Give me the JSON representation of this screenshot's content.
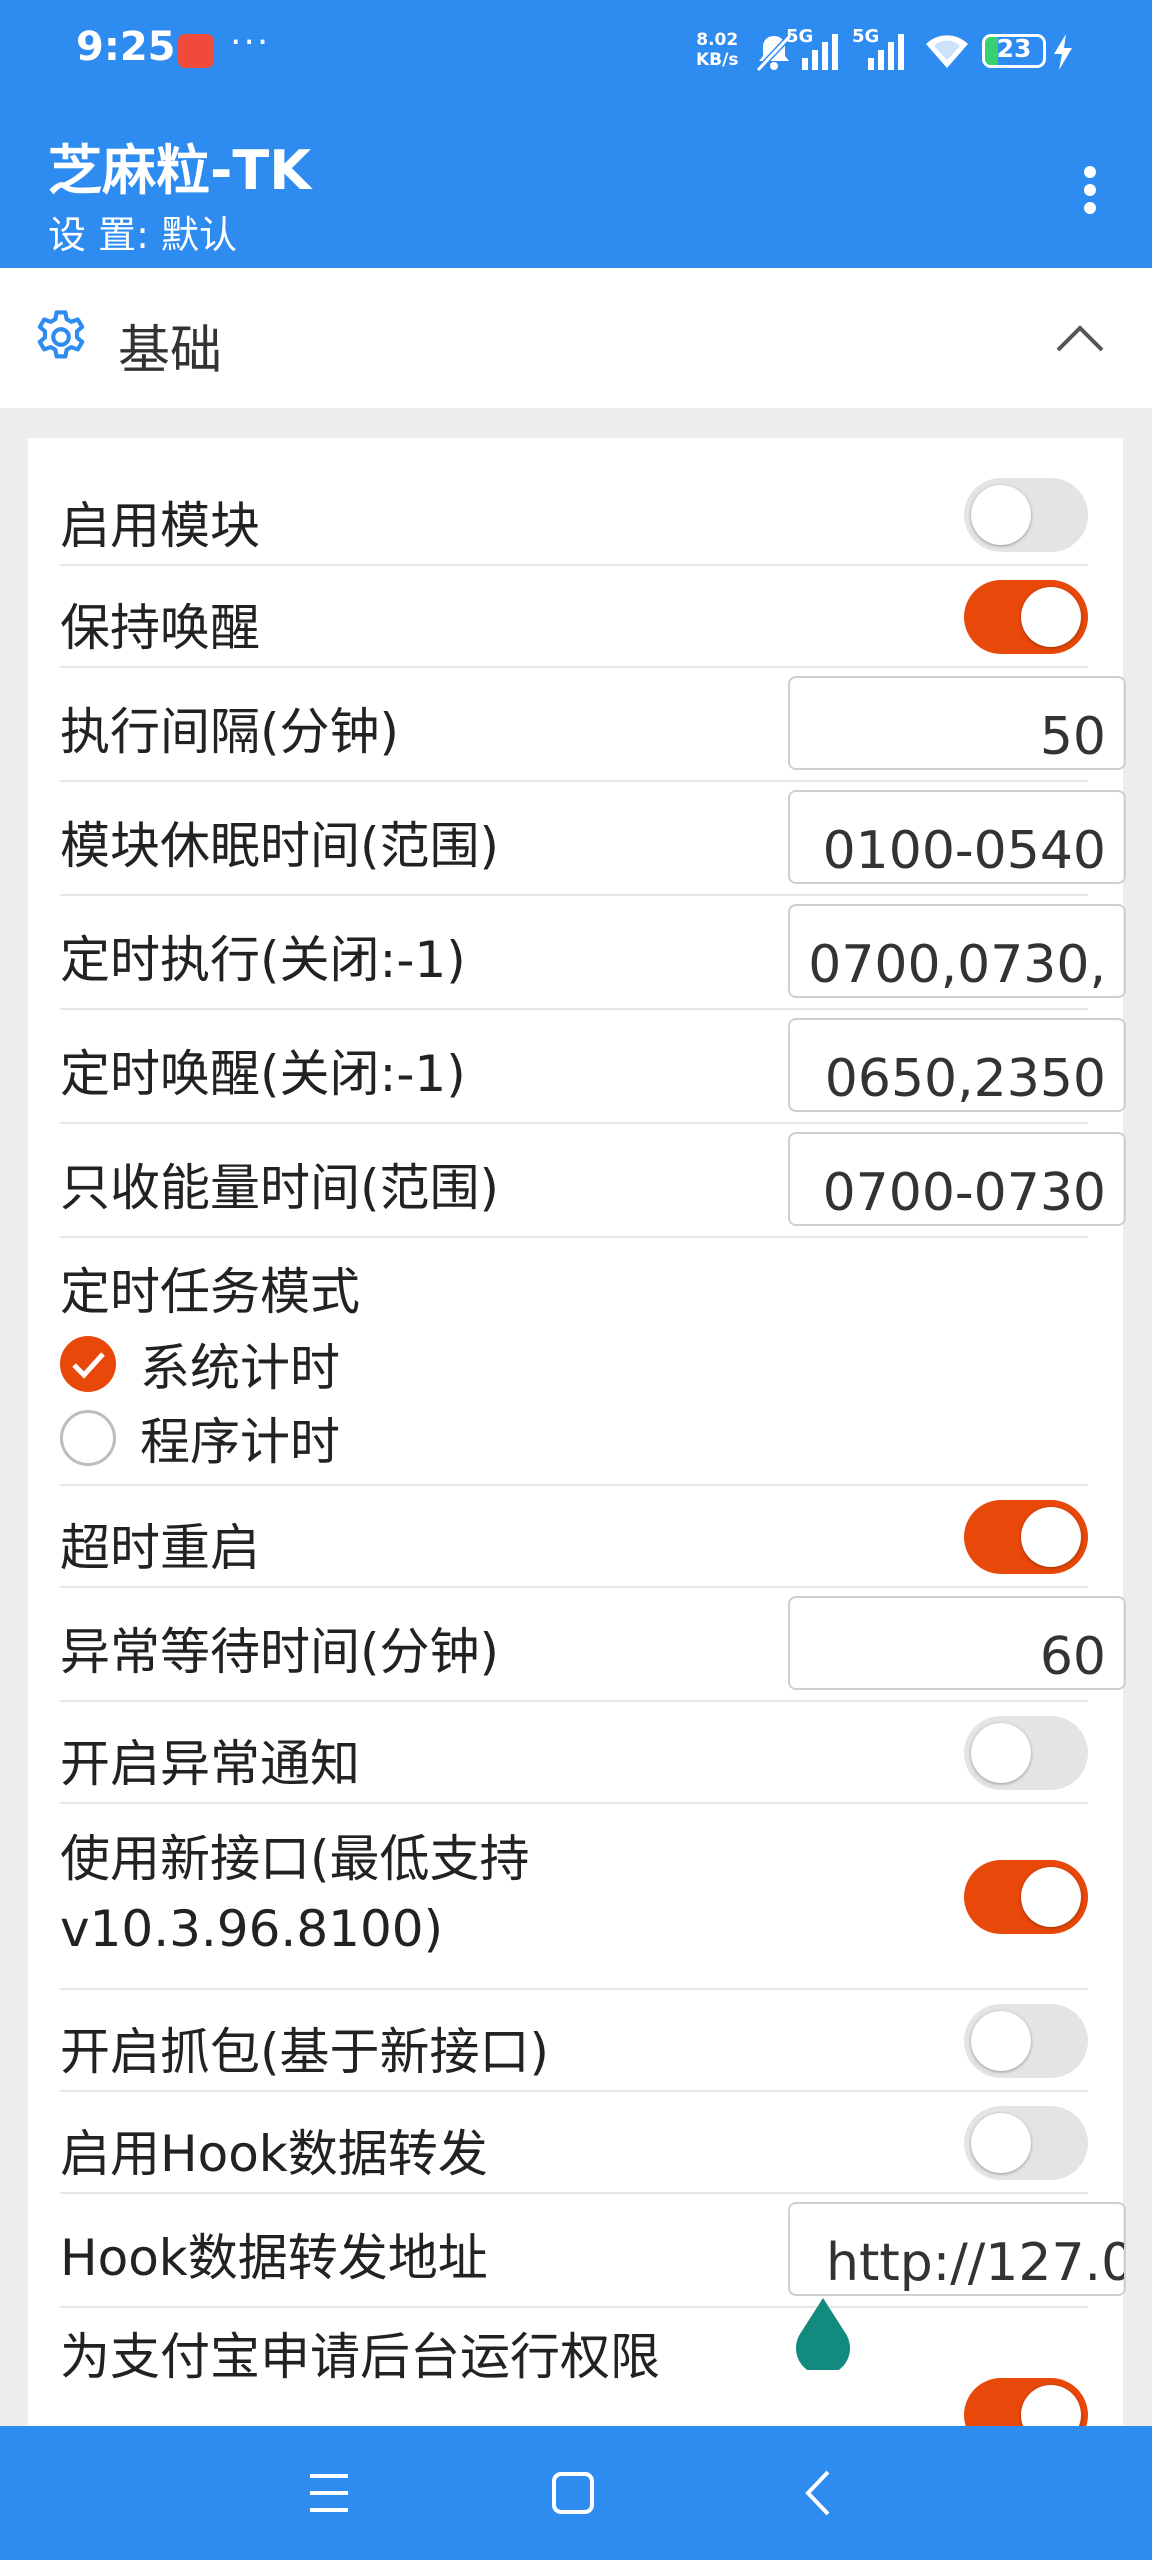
{
  "status_bar": {
    "time": "9:25",
    "more": "···",
    "speed_value": "8.02",
    "speed_unit": "KB/s",
    "network_1": "5G",
    "network_2": "5G",
    "battery": "23",
    "battery_level": 0.23,
    "icons": [
      "huawei-app-icon",
      "mute-bell-icon",
      "signal-icon",
      "wifi-icon",
      "battery-icon",
      "charging-icon"
    ]
  },
  "appbar": {
    "title": "芝麻粒-TK",
    "subtitle": "设 置: 默认",
    "overflow_icon": "more-vert-icon"
  },
  "section": {
    "title": "基础",
    "icon": "gear-icon",
    "collapse_icon": "chevron-up-icon"
  },
  "settings": [
    {
      "label": "启用模块",
      "type": "toggle",
      "on": false
    },
    {
      "label": "保持唤醒",
      "type": "toggle",
      "on": true
    },
    {
      "label": "执行间隔(分钟)",
      "type": "input",
      "value": "50"
    },
    {
      "label": "模块休眠时间(范围)",
      "type": "input",
      "value": "0100-0540"
    },
    {
      "label": "定时执行(关闭:-1)",
      "type": "input",
      "value": "0700,0730,"
    },
    {
      "label": "定时唤醒(关闭:-1)",
      "type": "input",
      "value": "0650,2350"
    },
    {
      "label": "只收能量时间(范围)",
      "type": "input",
      "value": "0700-0730"
    },
    {
      "label": "定时任务模式",
      "type": "radio",
      "options": [
        {
          "label": "系统计时",
          "checked": true
        },
        {
          "label": "程序计时",
          "checked": false
        }
      ]
    },
    {
      "label": "超时重启",
      "type": "toggle",
      "on": true
    },
    {
      "label": "异常等待时间(分钟)",
      "type": "input",
      "value": "60"
    },
    {
      "label": "开启异常通知",
      "type": "toggle",
      "on": false
    },
    {
      "label": "使用新接口(最低支持v10.3.96.8100)",
      "type": "toggle",
      "on": true
    },
    {
      "label": "开启抓包(基于新接口)",
      "type": "toggle",
      "on": false
    },
    {
      "label": "启用Hook数据转发",
      "type": "toggle",
      "on": false
    },
    {
      "label": "Hook数据转发地址",
      "type": "input",
      "value": "http://127.0"
    },
    {
      "label": "为支付宝申请后台运行权限",
      "type": "toggle",
      "on": true
    }
  ],
  "colors": {
    "primary": "#2e8bf0",
    "accent": "#e8480a",
    "toggle_off": "#e4e4e4"
  },
  "navbar": {
    "icons": [
      "menu-icon",
      "home-square-icon",
      "back-icon"
    ]
  }
}
